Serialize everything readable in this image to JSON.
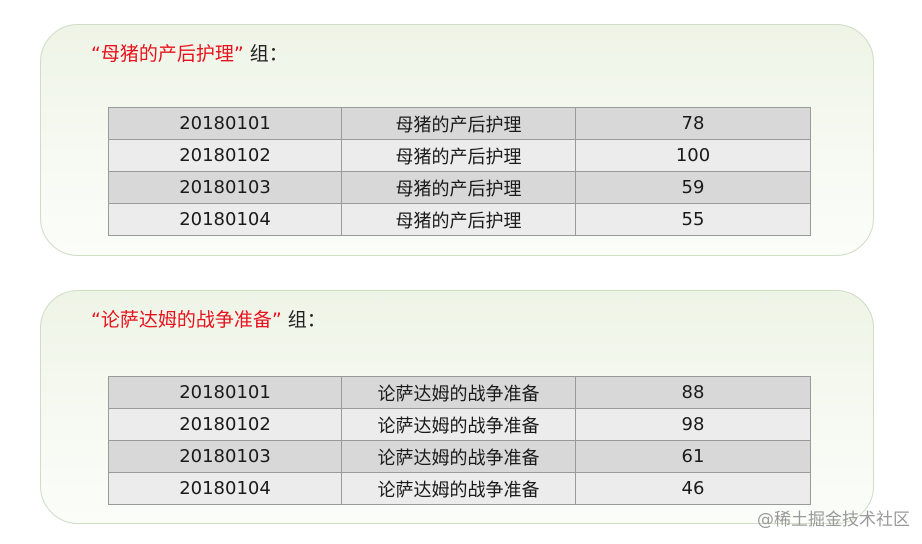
{
  "groups": [
    {
      "title": "“母猪的产后护理”",
      "title_suffix": "组：",
      "rows": [
        [
          "20180101",
          "母猪的产后护理",
          "78"
        ],
        [
          "20180102",
          "母猪的产后护理",
          "100"
        ],
        [
          "20180103",
          "母猪的产后护理",
          "59"
        ],
        [
          "20180104",
          "母猪的产后护理",
          "55"
        ]
      ]
    },
    {
      "title": "“论萨达姆的战争准备”",
      "title_suffix": "组：",
      "rows": [
        [
          "20180101",
          "论萨达姆的战争准备",
          "88"
        ],
        [
          "20180102",
          "论萨达姆的战争准备",
          "98"
        ],
        [
          "20180103",
          "论萨达姆的战争准备",
          "61"
        ],
        [
          "20180104",
          "论萨达姆的战争准备",
          "46"
        ]
      ]
    }
  ],
  "watermark": "@稀土掘金技术社区",
  "colors": {
    "title_red": "#e8121e",
    "panel_bg": "#eef4e6",
    "row_dark": "#d8d8d8",
    "row_light": "#ececec"
  }
}
